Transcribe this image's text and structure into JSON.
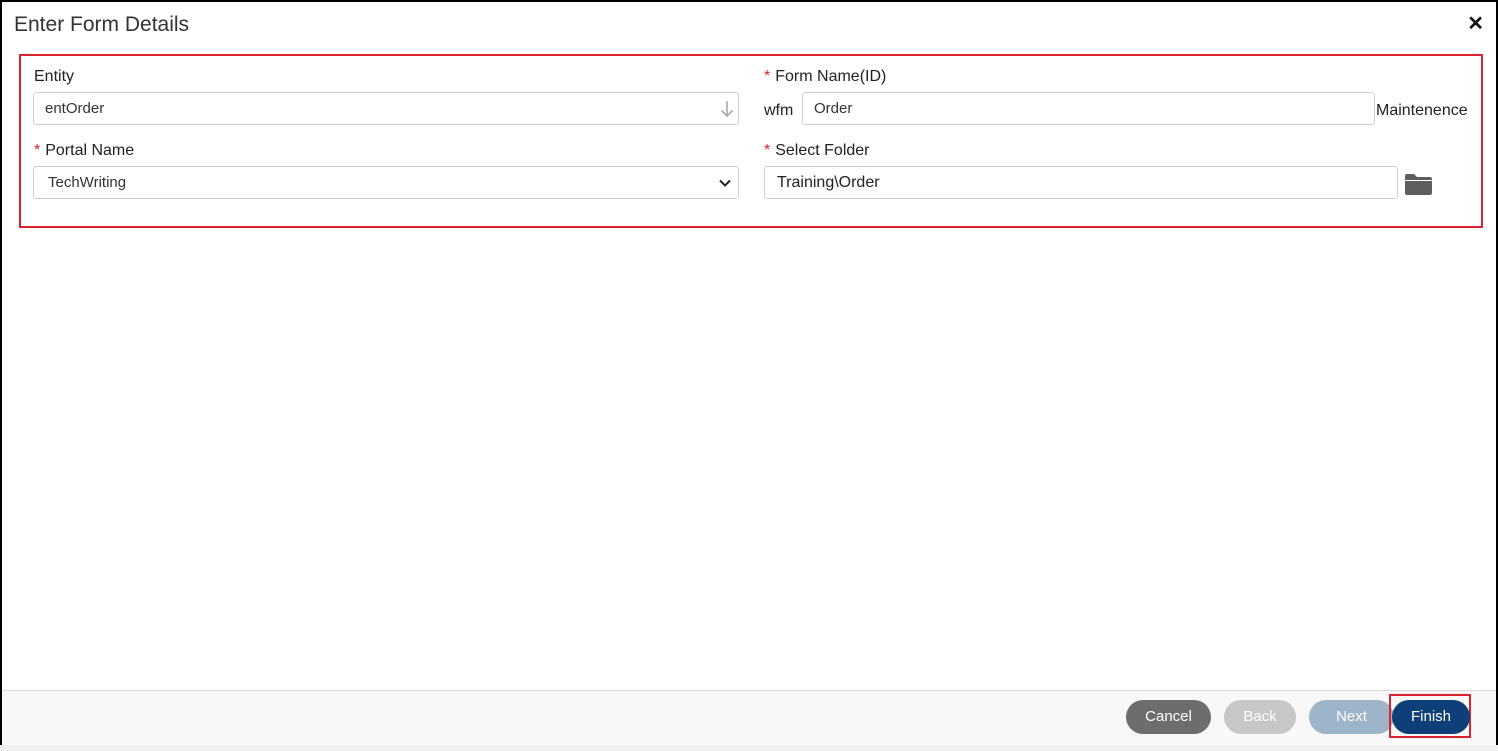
{
  "dialog": {
    "title": "Enter Form Details",
    "close_glyph": "✕"
  },
  "fields": {
    "entity": {
      "label": "Entity",
      "value": "entOrder",
      "icon": "down-arrow-icon"
    },
    "form_name": {
      "label": "Form Name(ID)",
      "required_mark": "*",
      "prefix": "wfm",
      "value": "Order",
      "suffix": "Maintenence"
    },
    "portal_name": {
      "label": "Portal Name",
      "required_mark": "*",
      "value": "TechWriting",
      "icon": "chevron-down-icon"
    },
    "select_folder": {
      "label": "Select Folder",
      "required_mark": "*",
      "value": "Training\\Order",
      "icon": "folder-icon"
    }
  },
  "footer": {
    "cancel_label": "Cancel",
    "back_label": "Back",
    "next_label": "Next",
    "finish_label": "Finish"
  },
  "colors": {
    "highlight": "#d9242f",
    "finish": "#0e3f78",
    "cancel": "#6d6d6d",
    "back_disabled": "#c7c7c7",
    "next_disabled": "#9eb4c8"
  }
}
